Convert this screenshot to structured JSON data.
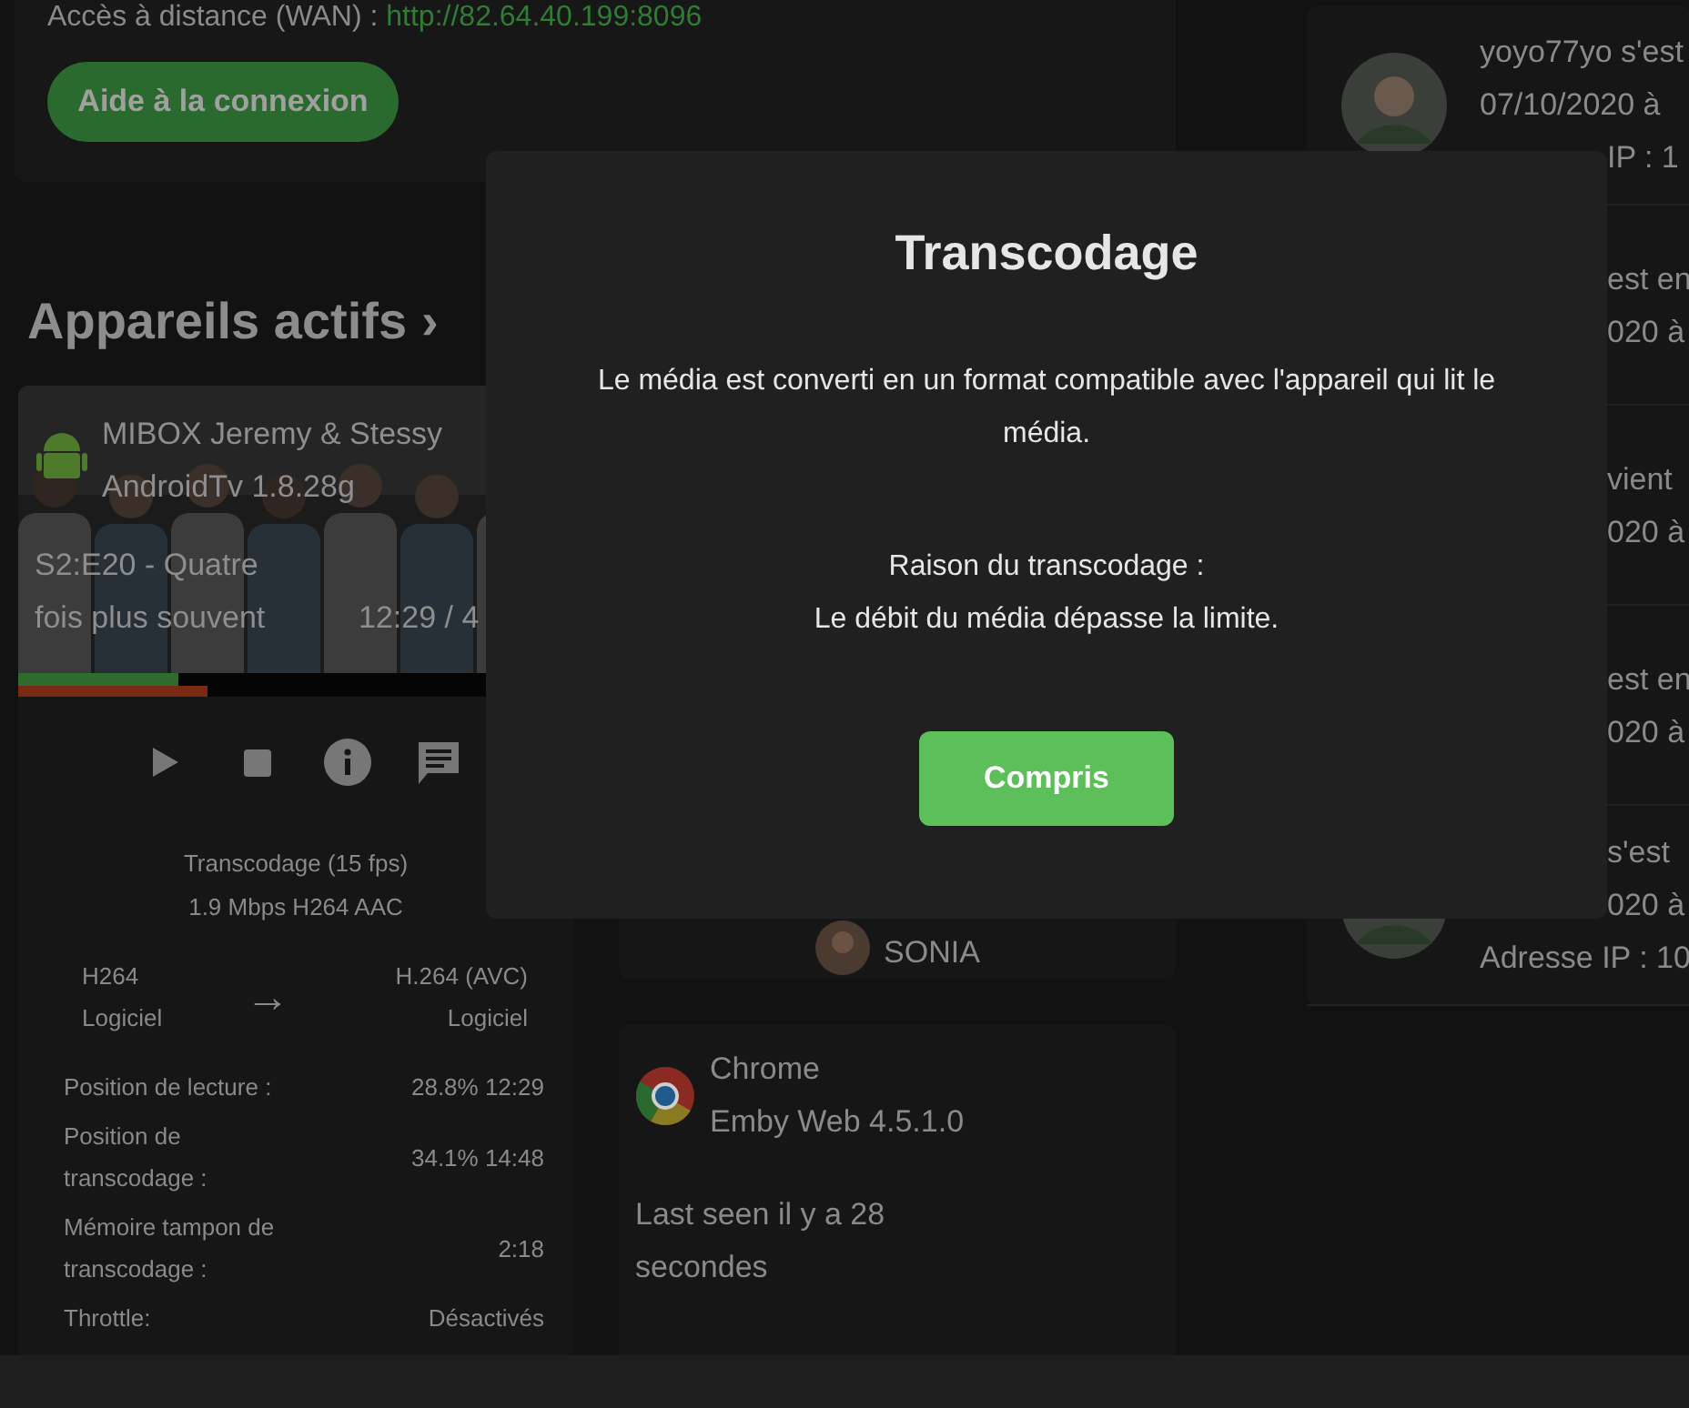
{
  "remote_access": {
    "label": "Accès à distance (WAN) :",
    "url": "http://82.64.40.199:8096"
  },
  "help_button": "Aide à la connexion",
  "section": {
    "title": "Appareils actifs",
    "chevron": "›"
  },
  "device": {
    "name": "MIBOX Jeremy & Stessy",
    "app": "AndroidTv 1.8.28g",
    "episode": "S2:E20 - Quatre fois plus souvent",
    "time": "12:29 / 4",
    "progress_bars": [
      {
        "kind": "playback",
        "level": 0.288
      },
      {
        "kind": "transcode",
        "level": 0.341
      }
    ],
    "controls": [
      {
        "kind": "play"
      },
      {
        "kind": "stop"
      },
      {
        "kind": "info"
      },
      {
        "kind": "message"
      }
    ],
    "stream_lines": [
      "Transcodage (15 fps)",
      "1.9 Mbps H264 AAC"
    ],
    "codec_from": [
      "H264",
      "Logiciel"
    ],
    "codec_arrow": "→",
    "codec_to": [
      "H.264 (AVC)",
      "Logiciel"
    ],
    "stats": [
      {
        "label": "Position de lecture :",
        "value": "28.8% 12:29"
      },
      {
        "label": "Position de transcodage :",
        "value": "34.1% 14:48"
      },
      {
        "label": "Mémoire tampon de transcodage :",
        "value": "2:18"
      },
      {
        "label": "Throttle:",
        "value": "Désactivés"
      }
    ]
  },
  "user_card": {
    "user": "SONIA"
  },
  "client_card": {
    "name": "Chrome",
    "app": "Emby Web 4.5.1.0",
    "last_seen": "Last seen il y a 28 secondes"
  },
  "activity": [
    {
      "avatar": true,
      "lines": [
        {
          "text": "yoyo77yo s'est",
          "kind": "full"
        },
        {
          "text": "07/10/2020 à",
          "kind": "full"
        },
        {
          "text": "IP : 1",
          "kind": "partial"
        }
      ]
    },
    {
      "avatar": false,
      "lines": [
        {
          "text": "est en",
          "kind": "partial"
        },
        {
          "text": "020 à",
          "kind": "partial"
        }
      ]
    },
    {
      "avatar": false,
      "lines": [
        {
          "text": "vient",
          "kind": "partial"
        },
        {
          "text": "020 à",
          "kind": "partial"
        }
      ]
    },
    {
      "avatar": false,
      "lines": [
        {
          "text": "est en",
          "kind": "partial"
        },
        {
          "text": "020 à",
          "kind": "partial"
        }
      ]
    },
    {
      "avatar": true,
      "lines": [
        {
          "text": "s'est",
          "kind": "partial"
        },
        {
          "text": "020 à",
          "kind": "partial"
        },
        {
          "text": "Adresse IP : 10",
          "kind": "full"
        }
      ]
    }
  ],
  "dialog": {
    "title": "Transcodage",
    "message": "Le média est converti en un format compatible avec l'appareil qui lit le média.",
    "reason_label": "Raison du transcodage :",
    "reason": "Le débit du média dépasse la limite.",
    "button": "Compris"
  }
}
